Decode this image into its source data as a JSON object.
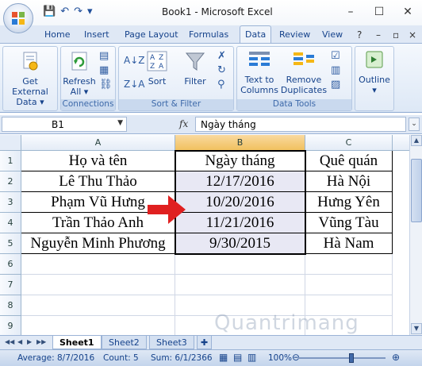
{
  "window": {
    "title": "Book1 - Microsoft Excel",
    "minimize": "–",
    "maximize": "☐",
    "close": "✕"
  },
  "qat": {
    "save": "💾",
    "undo": "↶",
    "redo": "↷",
    "customize": "▾"
  },
  "ribbon_tabs": [
    "Home",
    "Insert",
    "Page Layout",
    "Formulas",
    "Data",
    "Review",
    "View"
  ],
  "active_tab": "Data",
  "ribbon": {
    "external_data": {
      "line1": "Get External",
      "line2": "Data ▾"
    },
    "connections": {
      "refresh_line1": "Refresh",
      "refresh_line2": "All ▾",
      "group_label": "Connections"
    },
    "sort_filter": {
      "sort": "Sort",
      "filter": "Filter",
      "group_label": "Sort & Filter"
    },
    "data_tools": {
      "ttc_line1": "Text to",
      "ttc_line2": "Columns",
      "rd_line1": "Remove",
      "rd_line2": "Duplicates",
      "group_label": "Data Tools"
    },
    "outline": {
      "label": "Outline",
      "arrow": "▾"
    }
  },
  "formula_bar": {
    "name_box": "B1",
    "fx": "fx",
    "content": "Ngày tháng"
  },
  "columns": [
    "A",
    "B",
    "C"
  ],
  "rows": [
    "1",
    "2",
    "3",
    "4",
    "5",
    "6",
    "7",
    "8",
    "9"
  ],
  "table": [
    [
      "Họ và tên",
      "Ngày tháng",
      "Quê quán"
    ],
    [
      "Lê Thu Thảo",
      "12/17/2016",
      "Hà Nội"
    ],
    [
      "Phạm Vũ Hưng",
      "10/20/2016",
      "Hưng Yên"
    ],
    [
      "Trần Thảo Anh",
      "11/21/2016",
      "Vũng Tàu"
    ],
    [
      "Nguyễn Minh Phương",
      "9/30/2015",
      "Hà Nam"
    ]
  ],
  "sheet_tabs": [
    "Sheet1",
    "Sheet2",
    "Sheet3"
  ],
  "active_sheet": "Sheet1",
  "status_bar": {
    "average": "Average: 8/7/2016",
    "count": "Count: 5",
    "sum": "Sum: 6/1/2366",
    "zoom": "100%",
    "zoom_level": 1.0
  },
  "watermark": "Quantrimang",
  "accent_colors": {
    "arrow": "#e02020",
    "selected_header": "#f1c15f",
    "ribbon": "#dfe8f5"
  }
}
